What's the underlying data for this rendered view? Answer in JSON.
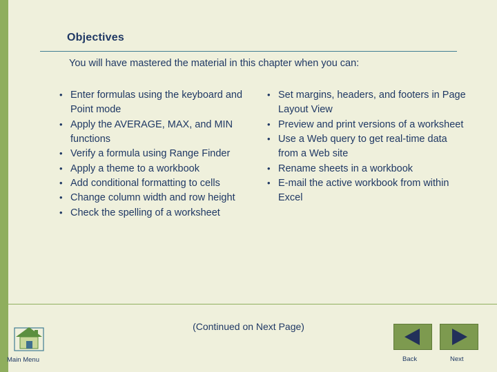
{
  "slide": {
    "title": "Objectives",
    "intro": "You will have mastered the material in this chapter when you can:",
    "columns": [
      {
        "bullets": [
          "Enter formulas using the keyboard and Point mode",
          "Apply the AVERAGE, MAX, and MIN functions",
          "Verify a formula using Range Finder",
          "Apply a theme to a workbook",
          "Add conditional formatting to cells",
          "Change column width and row height",
          "Check the spelling of a worksheet"
        ]
      },
      {
        "bullets": [
          "Set margins, headers, and footers in Page Layout View",
          "Preview and print versions of a worksheet",
          "Use a Web query to get real-time data from a Web site",
          "Rename sheets in a workbook",
          "E-mail the active workbook from within Excel"
        ]
      }
    ],
    "continued_note": "(Continued on Next Page)",
    "footer": {
      "main_menu_label": "Main Menu",
      "back_label": "Back",
      "next_label": "Next"
    },
    "colors": {
      "background": "#eff0dc",
      "accent_green": "#8fae5e",
      "title_rule": "#3f7c93",
      "text": "#1f3864",
      "nav_arrow": "#7d9a4f",
      "home_roof": "#5b8f3f"
    }
  }
}
